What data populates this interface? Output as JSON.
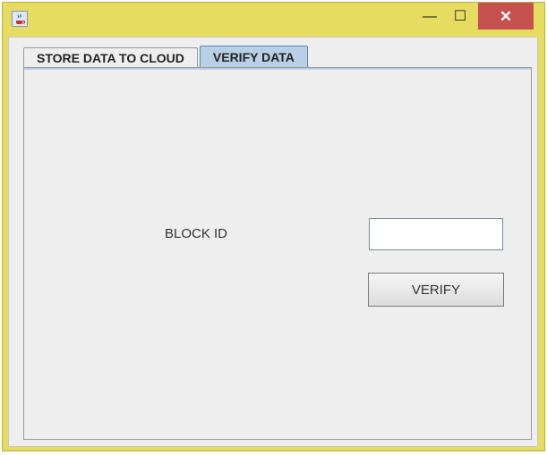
{
  "window": {
    "app_icon": "java-coffee-icon",
    "controls": {
      "minimize_glyph": "—",
      "maximize_glyph": "☐",
      "close_glyph": "✕"
    },
    "colors": {
      "frame": "#e6dc5f",
      "close_button": "#c75050",
      "selected_tab": "#b8cfe5"
    }
  },
  "tabs": [
    {
      "label": "STORE DATA TO CLOUD",
      "selected": false
    },
    {
      "label": "VERIFY DATA",
      "selected": true
    }
  ],
  "verify_panel": {
    "block_id_label": "BLOCK ID",
    "block_id_value": "",
    "verify_button_label": "VERIFY"
  }
}
